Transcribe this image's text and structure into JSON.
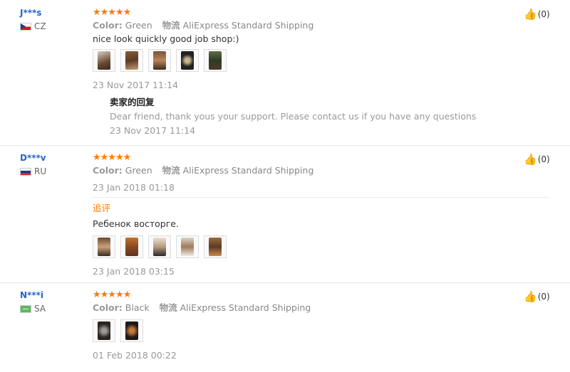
{
  "reviews": [
    {
      "user": "J***s",
      "country": "CZ",
      "stars": "★★★★★",
      "color_label": "Color:",
      "color_value": "Green",
      "shipping_label": "物流",
      "shipping_value": "AliExpress Standard Shipping",
      "text": "nice look quickly good job shop:)",
      "date": "23 Nov 2017 11:14",
      "helpful": "(0)",
      "reply": {
        "title": "卖家的回复",
        "text": "Dear friend, thank yous your support. Please contact us if you have any questions",
        "date": "23 Nov 2017 11:14"
      },
      "photo_count": 5
    },
    {
      "user": "D***v",
      "country": "RU",
      "stars": "★★★★★",
      "color_label": "Color:",
      "color_value": "Green",
      "shipping_label": "物流",
      "shipping_value": "AliExpress Standard Shipping",
      "date": "23 Jan 2018 01:18",
      "helpful": "(0)",
      "additional": {
        "label": "追评",
        "text": "Ребенок восторге.",
        "date": "23 Jan 2018 03:15"
      },
      "photo_count": 5
    },
    {
      "user": "N***i",
      "country": "SA",
      "stars": "★★★★★",
      "color_label": "Color:",
      "color_value": "Black",
      "shipping_label": "物流",
      "shipping_value": "AliExpress Standard Shipping",
      "date": "01 Feb 2018 00:22",
      "helpful": "(0)",
      "photo_count": 2
    }
  ],
  "colors": {
    "star": "#ff7a00",
    "username": "#2267c7",
    "muted": "#999999",
    "additional": "#ff7a00"
  },
  "icons": {
    "like": "thumbs-up-icon"
  }
}
